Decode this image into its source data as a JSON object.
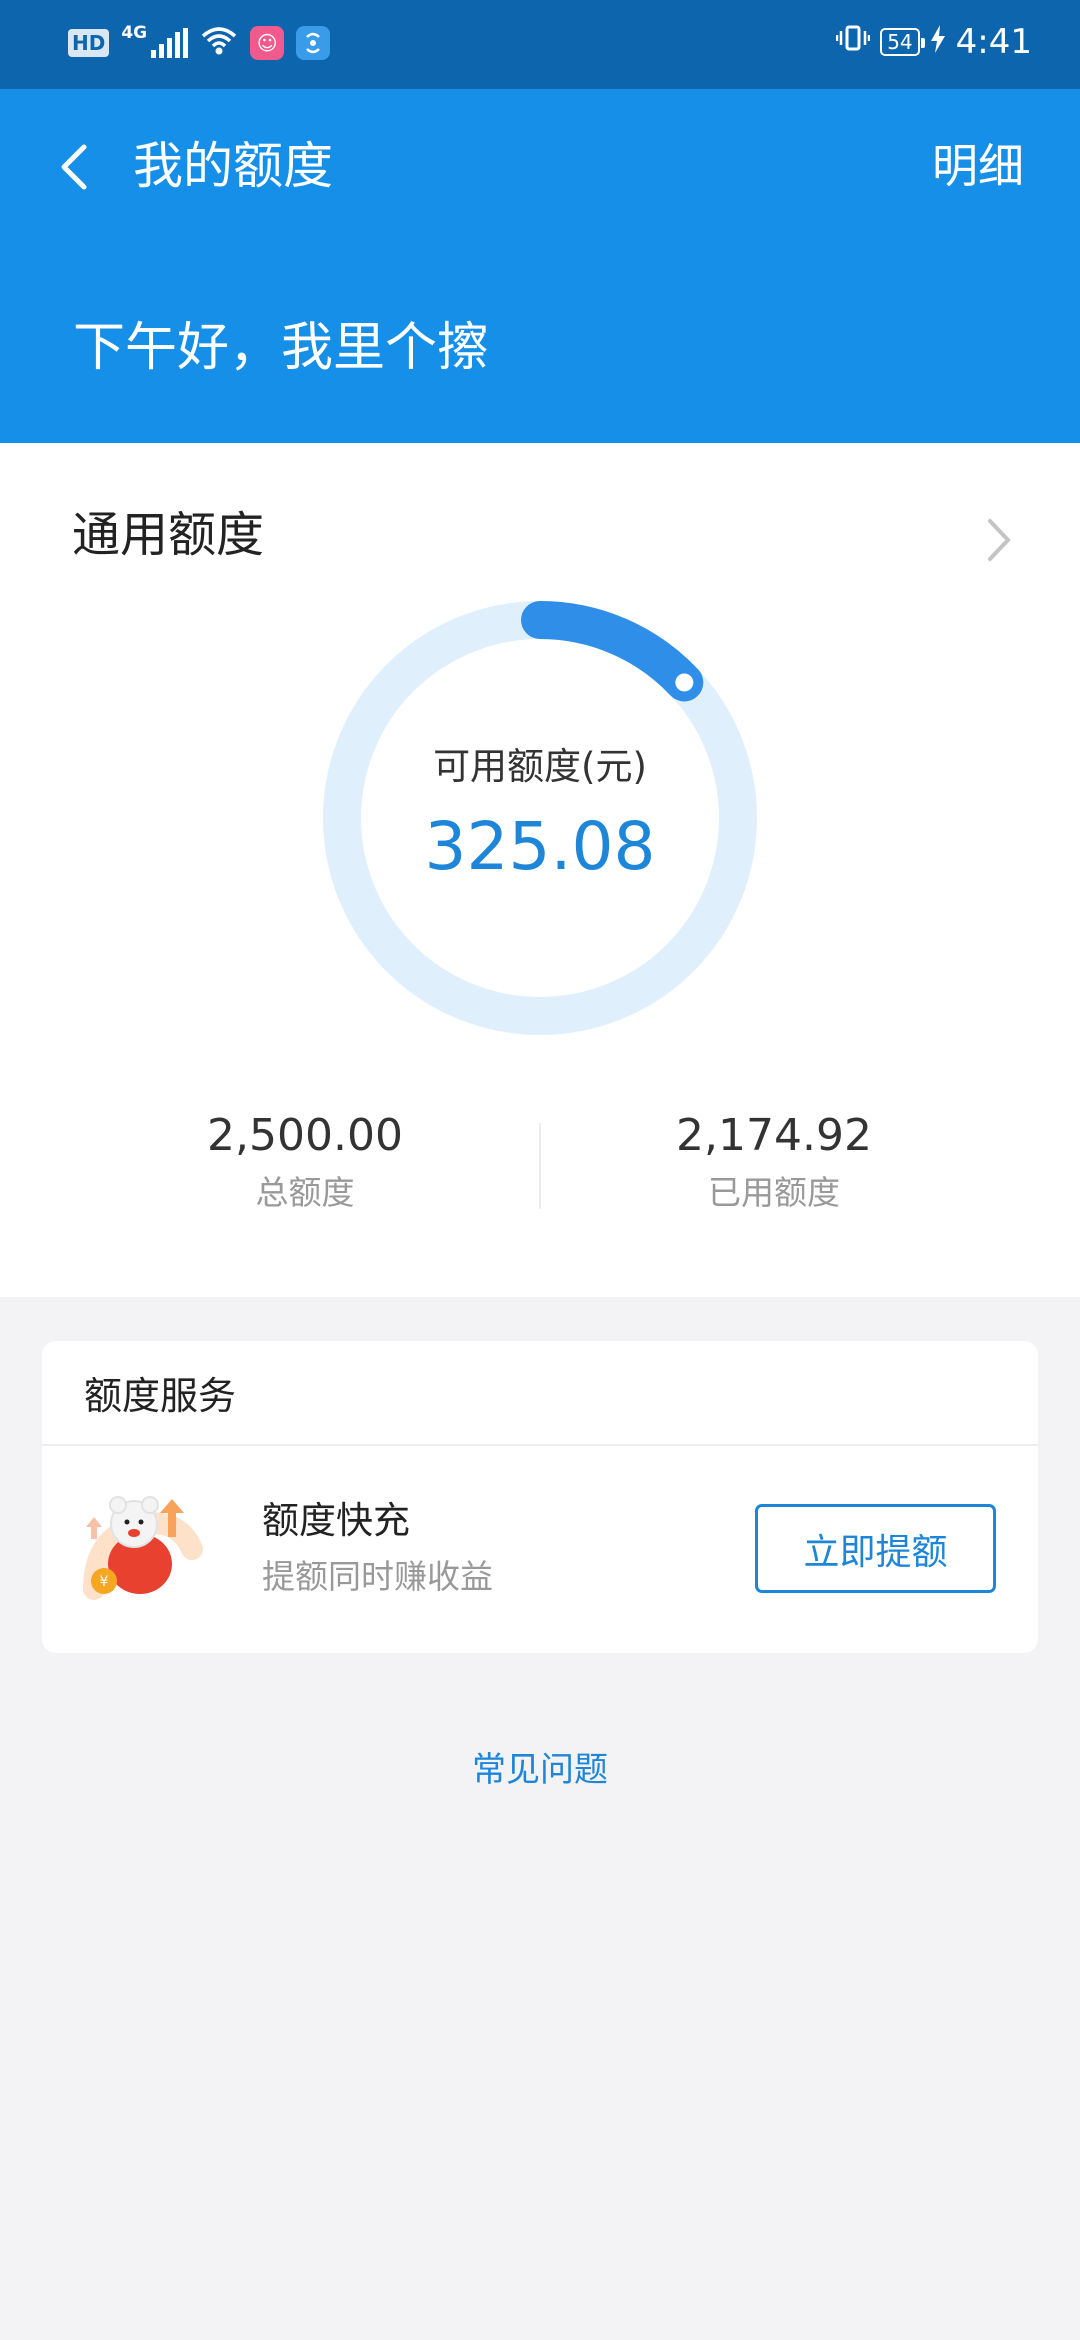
{
  "status_bar": {
    "hd": "HD",
    "network": "4G",
    "battery": "54",
    "time": "4:41"
  },
  "header": {
    "title": "我的额度",
    "detail_link": "明细",
    "greeting": "下午好，我里个擦"
  },
  "quota": {
    "section_title": "通用额度",
    "available_label": "可用额度(元)",
    "available_value": "325.08",
    "available_fraction": 0.13,
    "total_value": "2,500.00",
    "total_label": "总额度",
    "used_value": "2,174.92",
    "used_label": "已用额度"
  },
  "services": {
    "header": "额度服务",
    "item": {
      "name": "额度快充",
      "description": "提额同时赚收益",
      "button": "立即提额"
    }
  },
  "faq_link": "常见问题",
  "colors": {
    "status_bar": "#0d66ad",
    "header": "#168fe8",
    "accent": "#1d86d8",
    "ring_track": "#dff0fc",
    "ring_progress": "#2f8ee8"
  }
}
